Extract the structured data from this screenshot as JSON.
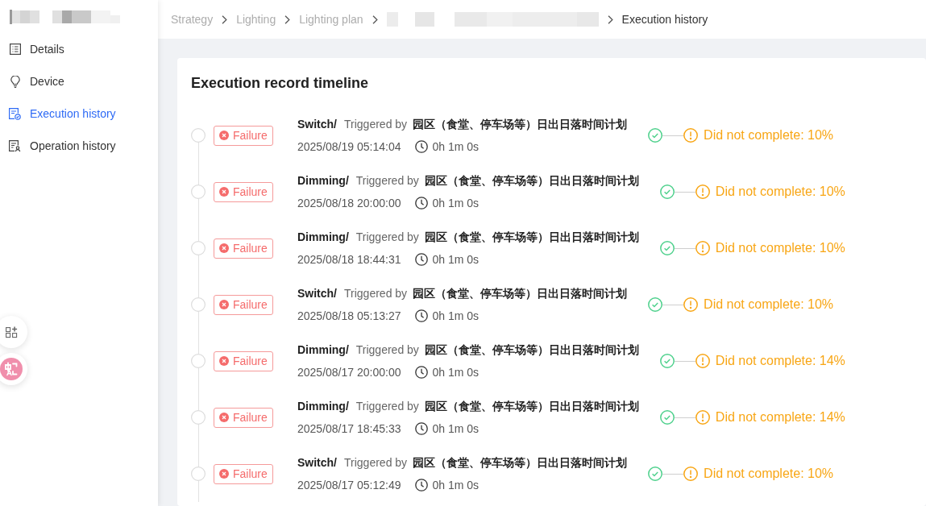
{
  "sidebar": {
    "items": [
      {
        "label": "Details",
        "selected": false
      },
      {
        "label": "Device",
        "selected": false
      },
      {
        "label": "Execution history",
        "selected": true
      },
      {
        "label": "Operation history",
        "selected": false
      }
    ]
  },
  "breadcrumb": [
    {
      "kind": "link",
      "label": "Strategy"
    },
    {
      "kind": "link",
      "label": "Lighting"
    },
    {
      "kind": "link",
      "label": "Lighting plan"
    },
    {
      "kind": "redacted"
    },
    {
      "kind": "current",
      "label": "Execution history"
    }
  ],
  "timeline": {
    "title": "Execution record timeline",
    "records": [
      {
        "failed": true,
        "status": "Failure",
        "type": "Switch/",
        "trigger_label": "Triggered by",
        "plan": "园区（食堂、停车场等）日出日落时间计划",
        "time": "2025/08/19 05:14:04",
        "duration": "0h 1m 0s",
        "steps": [
          {
            "kind": "done"
          },
          {
            "kind": "warning",
            "label": "Did not complete: 10%"
          }
        ]
      },
      {
        "failed": true,
        "status": "Failure",
        "type": "Dimming/",
        "trigger_label": "Triggered by",
        "plan": "园区（食堂、停车场等）日出日落时间计划",
        "time": "2025/08/18 20:00:00",
        "duration": "0h 1m 0s",
        "steps": [
          {
            "kind": "done"
          },
          {
            "kind": "warning",
            "label": "Did not complete: 10%"
          }
        ]
      },
      {
        "failed": true,
        "status": "Failure",
        "type": "Dimming/",
        "trigger_label": "Triggered by",
        "plan": "园区（食堂、停车场等）日出日落时间计划",
        "time": "2025/08/18 18:44:31",
        "duration": "0h 1m 0s",
        "steps": [
          {
            "kind": "done"
          },
          {
            "kind": "warning",
            "label": "Did not complete: 10%"
          }
        ]
      },
      {
        "failed": true,
        "status": "Failure",
        "type": "Switch/",
        "trigger_label": "Triggered by",
        "plan": "园区（食堂、停车场等）日出日落时间计划",
        "time": "2025/08/18 05:13:27",
        "duration": "0h 1m 0s",
        "steps": [
          {
            "kind": "done"
          },
          {
            "kind": "warning",
            "label": "Did not complete: 10%"
          }
        ]
      },
      {
        "failed": true,
        "status": "Failure",
        "type": "Dimming/",
        "trigger_label": "Triggered by",
        "plan": "园区（食堂、停车场等）日出日落时间计划",
        "time": "2025/08/17 20:00:00",
        "duration": "0h 1m 0s",
        "steps": [
          {
            "kind": "done"
          },
          {
            "kind": "warning",
            "label": "Did not complete: 14%"
          }
        ]
      },
      {
        "failed": true,
        "status": "Failure",
        "type": "Dimming/",
        "trigger_label": "Triggered by",
        "plan": "园区（食堂、停车场等）日出日落时间计划",
        "time": "2025/08/17 18:45:33",
        "duration": "0h 1m 0s",
        "steps": [
          {
            "kind": "done"
          },
          {
            "kind": "warning",
            "label": "Did not complete: 14%"
          }
        ]
      },
      {
        "failed": true,
        "status": "Failure",
        "type": "Switch/",
        "trigger_label": "Triggered by",
        "plan": "园区（食堂、停车场等）日出日落时间计划",
        "time": "2025/08/17 05:12:49",
        "duration": "0h 1m 0s",
        "steps": [
          {
            "kind": "done"
          },
          {
            "kind": "warning",
            "label": "Did not complete: 10%"
          }
        ]
      }
    ]
  }
}
